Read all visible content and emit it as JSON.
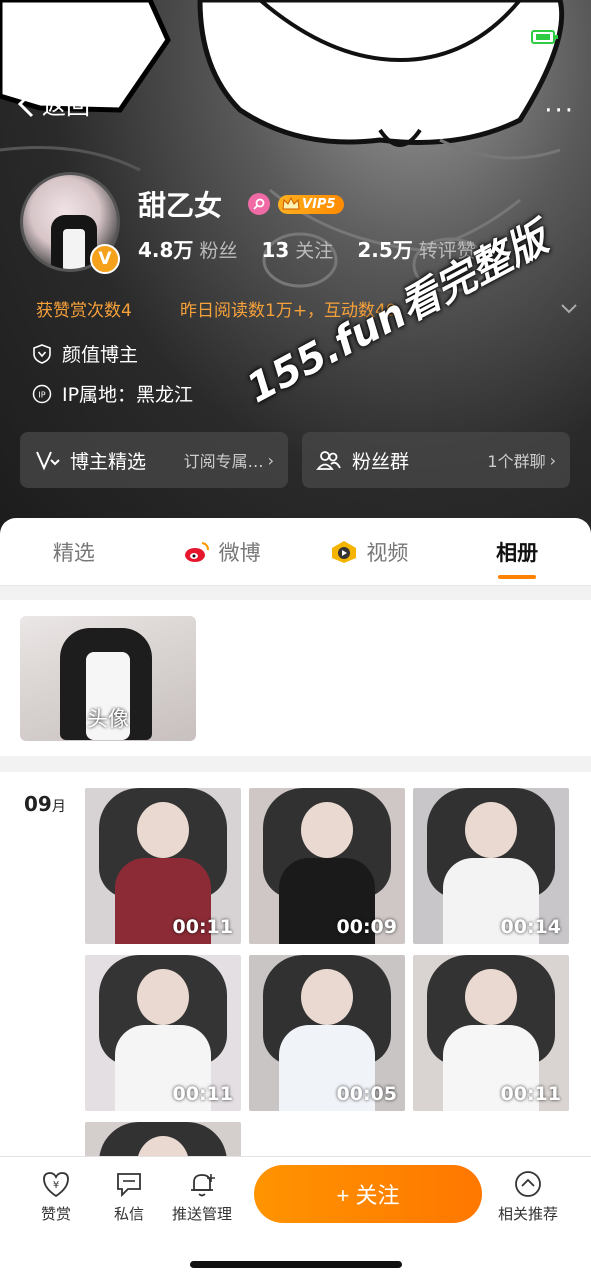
{
  "header": {
    "back_label": "返回",
    "username": "甜乙女",
    "vip_label": "VIP5",
    "verified_glyph": "V",
    "stats": [
      {
        "num": "4.8万",
        "label": "粉丝"
      },
      {
        "num": "13",
        "label": "关注"
      },
      {
        "num": "2.5万",
        "label": "转评赞"
      }
    ],
    "honor_1": "获赞赏次数4",
    "honor_2": "昨日阅读数1万+，互动数49",
    "tag": "颜值博主",
    "ip": "IP属地：黑龙江",
    "watermark": "155.fun看完整版",
    "card_1": {
      "title": "博主精选",
      "sub": "订阅专属…"
    },
    "card_2": {
      "title": "粉丝群",
      "sub": "1个群聊"
    }
  },
  "tabs": [
    {
      "label": "精选"
    },
    {
      "label": "微博"
    },
    {
      "label": "视频"
    },
    {
      "label": "相册"
    }
  ],
  "active_tab": "相册",
  "album": {
    "label": "头像"
  },
  "month": {
    "num": "09",
    "unit": "月"
  },
  "videos": [
    {
      "duration": "00:11",
      "top_color": "#8c2b35",
      "bg": "#d7d3d4"
    },
    {
      "duration": "00:09",
      "top_color": "#1a1a1a",
      "bg": "#cfc7c6"
    },
    {
      "duration": "00:14",
      "top_color": "#f3f3f3",
      "bg": "#c8c6c9"
    },
    {
      "duration": "00:11",
      "top_color": "#f5f5f5",
      "bg": "#e3dfe3"
    },
    {
      "duration": "00:05",
      "top_color": "#f0f3f8",
      "bg": "#c9c5c5"
    },
    {
      "duration": "00:11",
      "top_color": "#f6f6f6",
      "bg": "#d9d4d2"
    }
  ],
  "bottom": {
    "reward": "赞赏",
    "message": "私信",
    "push": "推送管理",
    "follow": "+ 关注",
    "recommend": "相关推荐"
  }
}
